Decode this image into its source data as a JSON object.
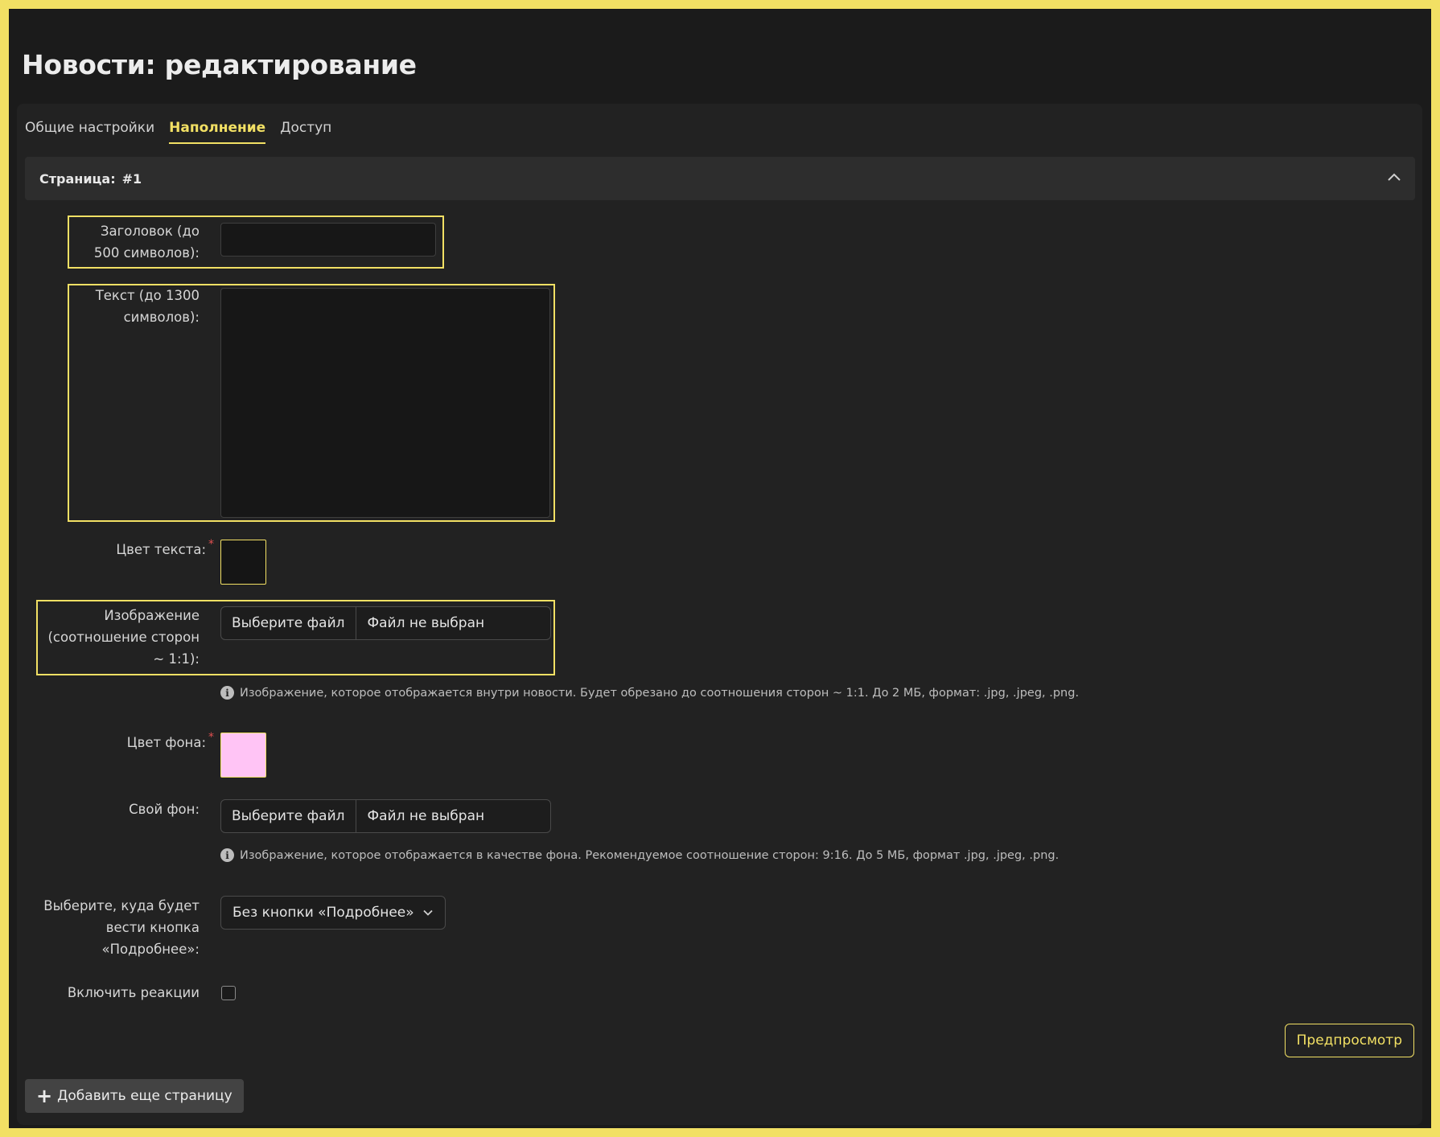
{
  "title": "Новости: редактирование",
  "tabs": [
    {
      "label": "Общие настройки",
      "active": false
    },
    {
      "label": "Наполнение",
      "active": true
    },
    {
      "label": "Доступ",
      "active": false
    }
  ],
  "page_section": {
    "label": "Страница:",
    "number": "#1"
  },
  "fields": {
    "heading": {
      "label": "Заголовок (до 500 символов):",
      "value": ""
    },
    "text": {
      "label": "Текст (до 1300 символов):",
      "value": ""
    },
    "text_color": {
      "label": "Цвет текста:",
      "required": "*",
      "value": "#151515"
    },
    "image": {
      "label": "Изображение (соотношение сторон ~ 1:1):",
      "button": "Выберите файл",
      "status": "Файл не выбран",
      "hint": "Изображение, которое отображается внутри новости. Будет обрезано до соотношения сторон ~ 1:1. До 2 МБ, формат: .jpg, .jpeg, .png."
    },
    "bg_color": {
      "label": "Цвет фона:",
      "required": "*",
      "value": "#ffc4f5"
    },
    "custom_bg": {
      "label": "Свой фон:",
      "button": "Выберите файл",
      "status": "Файл не выбран",
      "hint": "Изображение, которое отображается в качестве фона. Рекомендуемое соотношение сторон: 9:16. До 5 МБ, формат .jpg, .jpeg, .png."
    },
    "more_button": {
      "label": "Выберите, куда будет вести кнопка «Подробнее»:",
      "selected": "Без кнопки «Подробнее»"
    },
    "reactions": {
      "label": "Включить реакции",
      "checked": false
    }
  },
  "buttons": {
    "preview": "Предпросмотр",
    "add_page": "Добавить еще страницу"
  },
  "icons": {
    "collapse": "chevron-up-icon",
    "select": "chevron-down-icon",
    "hint": "info-icon",
    "add": "plus-icon"
  },
  "colors": {
    "accent": "#f2e064",
    "background": "#1b1b1b",
    "panel": "#222222",
    "required": "#e05050"
  }
}
